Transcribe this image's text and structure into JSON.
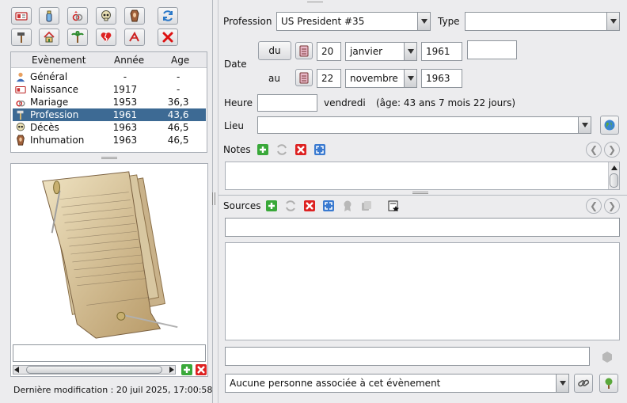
{
  "events_table": {
    "headers": {
      "event": "Evènement",
      "year": "Année",
      "age": "Age"
    },
    "rows": [
      {
        "name": "Général",
        "year": "-",
        "age": "-"
      },
      {
        "name": "Naissance",
        "year": "1917",
        "age": "-"
      },
      {
        "name": "Mariage",
        "year": "1953",
        "age": "36,3"
      },
      {
        "name": "Profession",
        "year": "1961",
        "age": "43,6"
      },
      {
        "name": "Décès",
        "year": "1963",
        "age": "46,5"
      },
      {
        "name": "Inhumation",
        "year": "1963",
        "age": "46,5"
      }
    ]
  },
  "status": {
    "last_modified": "Dernière modification : 20 juil 2025, 17:00:58"
  },
  "form": {
    "profession_label": "Profession",
    "profession_value": "US President #35",
    "type_label": "Type",
    "type_value": "",
    "date_label": "Date",
    "from_button": "du",
    "to_label": "au",
    "from_day": "20",
    "from_month": "janvier",
    "from_year": "1961",
    "from_extra": "",
    "to_day": "22",
    "to_month": "novembre",
    "to_year": "1963",
    "time_label": "Heure",
    "time_value": "",
    "weekday": "vendredi",
    "age_text": "(âge: 43 ans 7 mois 22 jours)",
    "place_label": "Lieu",
    "place_value": "",
    "notes_label": "Notes",
    "sources_label": "Sources",
    "source_title_value": "",
    "source_footer_value": "",
    "associated_people": "Aucune personne associée à cet évènement"
  },
  "media": {
    "caption_value": ""
  },
  "colors": {
    "selection": "#3d6a94",
    "background": "#ececee"
  }
}
